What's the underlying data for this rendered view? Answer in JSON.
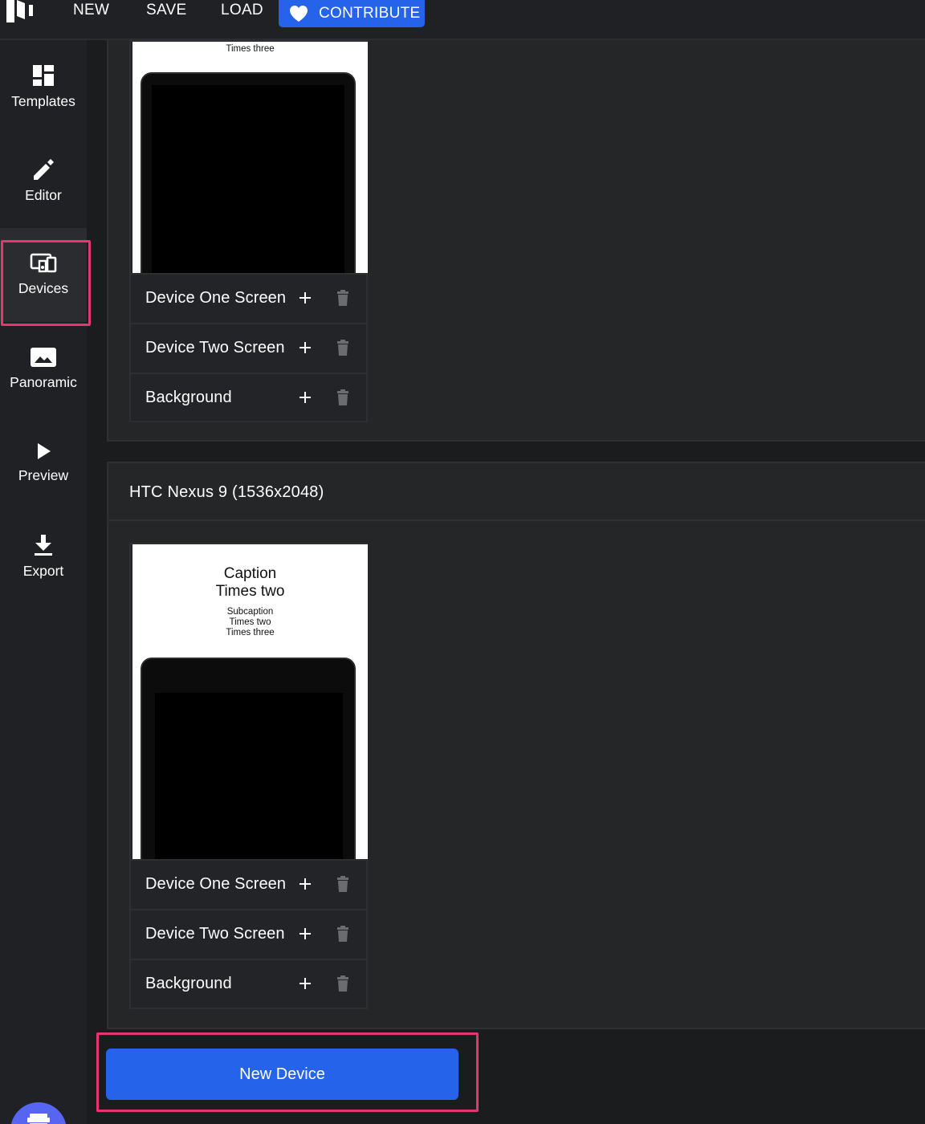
{
  "topbar": {
    "new_label": "NEW",
    "save_label": "SAVE",
    "load_label": "LOAD",
    "contribute_label": "CONTRIBUTE"
  },
  "sidebar": {
    "items": [
      {
        "label": "Templates",
        "icon": "templates-icon"
      },
      {
        "label": "Editor",
        "icon": "pencil-icon"
      },
      {
        "label": "Devices",
        "icon": "devices-icon"
      },
      {
        "label": "Panoramic",
        "icon": "image-icon"
      },
      {
        "label": "Preview",
        "icon": "play-icon"
      },
      {
        "label": "Export",
        "icon": "download-icon"
      }
    ],
    "active": "Devices"
  },
  "devices": [
    {
      "title": "",
      "preview_caption_tail": "Times three",
      "rows": [
        "Device One Screen",
        "Device Two Screen",
        "Background"
      ]
    },
    {
      "title": "HTC Nexus 9 (1536x2048)",
      "caption_line1": "Caption",
      "caption_line2": "Times two",
      "subcaption_line1": "Subcaption",
      "subcaption_line2": "Times two",
      "subcaption_line3": "Times three",
      "rows": [
        "Device One Screen",
        "Device Two Screen",
        "Background"
      ]
    }
  ],
  "new_device_label": "New Device",
  "colors": {
    "accent": "#2563eb",
    "highlight": "#e8356d",
    "background": "#1b1c1e"
  }
}
